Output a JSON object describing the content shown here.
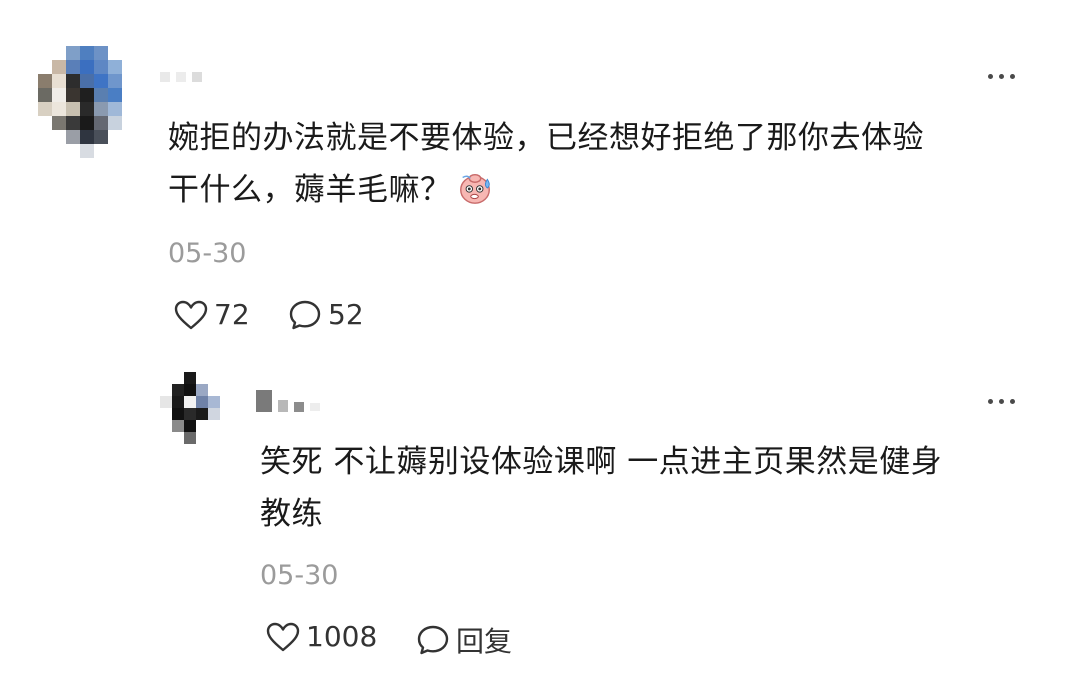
{
  "comment": {
    "line1": "婉拒的办法就是不要体验，已经想好拒绝了那你去体验",
    "line2": "干什么，薅羊毛嘛？",
    "emoji": "sweat-emoji",
    "date": "05-30",
    "likes": "72",
    "replies": "52"
  },
  "reply": {
    "line1": "笑死 不让薅别设体验课啊 一点进主页果然是健身",
    "line2": "教练",
    "date": "05-30",
    "likes": "1008",
    "reply_label": "回复"
  },
  "icons": {
    "more": "more-icon",
    "like": "heart-icon",
    "comment": "comment-icon"
  }
}
